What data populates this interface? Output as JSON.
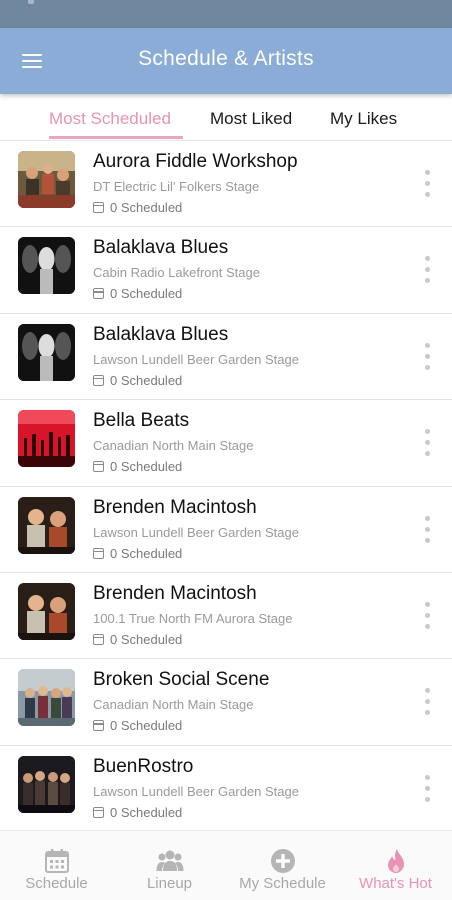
{
  "header": {
    "title": "Schedule & Artists",
    "menu_icon": "hamburger-menu-icon"
  },
  "tabs": [
    {
      "label": "Most Scheduled",
      "active": true
    },
    {
      "label": "Most Liked",
      "active": false
    },
    {
      "label": "My Likes",
      "active": false
    }
  ],
  "colors": {
    "status_bar": "#6f879f",
    "app_bar": "#8aacd6",
    "accent_pink": "#e893b4",
    "muted_text": "#9a9a9a"
  },
  "artists": [
    {
      "name": "Aurora Fiddle Workshop",
      "stage": "DT Electric Lil' Folkers Stage",
      "scheduled": "0 Scheduled"
    },
    {
      "name": "Balaklava Blues",
      "stage": "Cabin Radio Lakefront Stage",
      "scheduled": "0 Scheduled"
    },
    {
      "name": "Balaklava Blues",
      "stage": "Lawson Lundell Beer Garden Stage",
      "scheduled": "0 Scheduled"
    },
    {
      "name": "Bella Beats",
      "stage": "Canadian North Main Stage",
      "scheduled": "0 Scheduled"
    },
    {
      "name": "Brenden Macintosh",
      "stage": "Lawson Lundell Beer Garden Stage",
      "scheduled": "0 Scheduled"
    },
    {
      "name": "Brenden Macintosh",
      "stage": "100.1 True North FM Aurora Stage",
      "scheduled": "0 Scheduled"
    },
    {
      "name": "Broken Social Scene",
      "stage": "Canadian North Main Stage",
      "scheduled": "0 Scheduled"
    },
    {
      "name": "BuenRostro",
      "stage": "Lawson Lundell Beer Garden Stage",
      "scheduled": "0 Scheduled"
    }
  ],
  "bottom_nav": [
    {
      "label": "Schedule",
      "icon": "calendar-icon",
      "active": false
    },
    {
      "label": "Lineup",
      "icon": "people-group-icon",
      "active": false
    },
    {
      "label": "My Schedule",
      "icon": "plus-circle-icon",
      "active": false
    },
    {
      "label": "What's Hot",
      "icon": "flame-icon",
      "active": true
    }
  ]
}
